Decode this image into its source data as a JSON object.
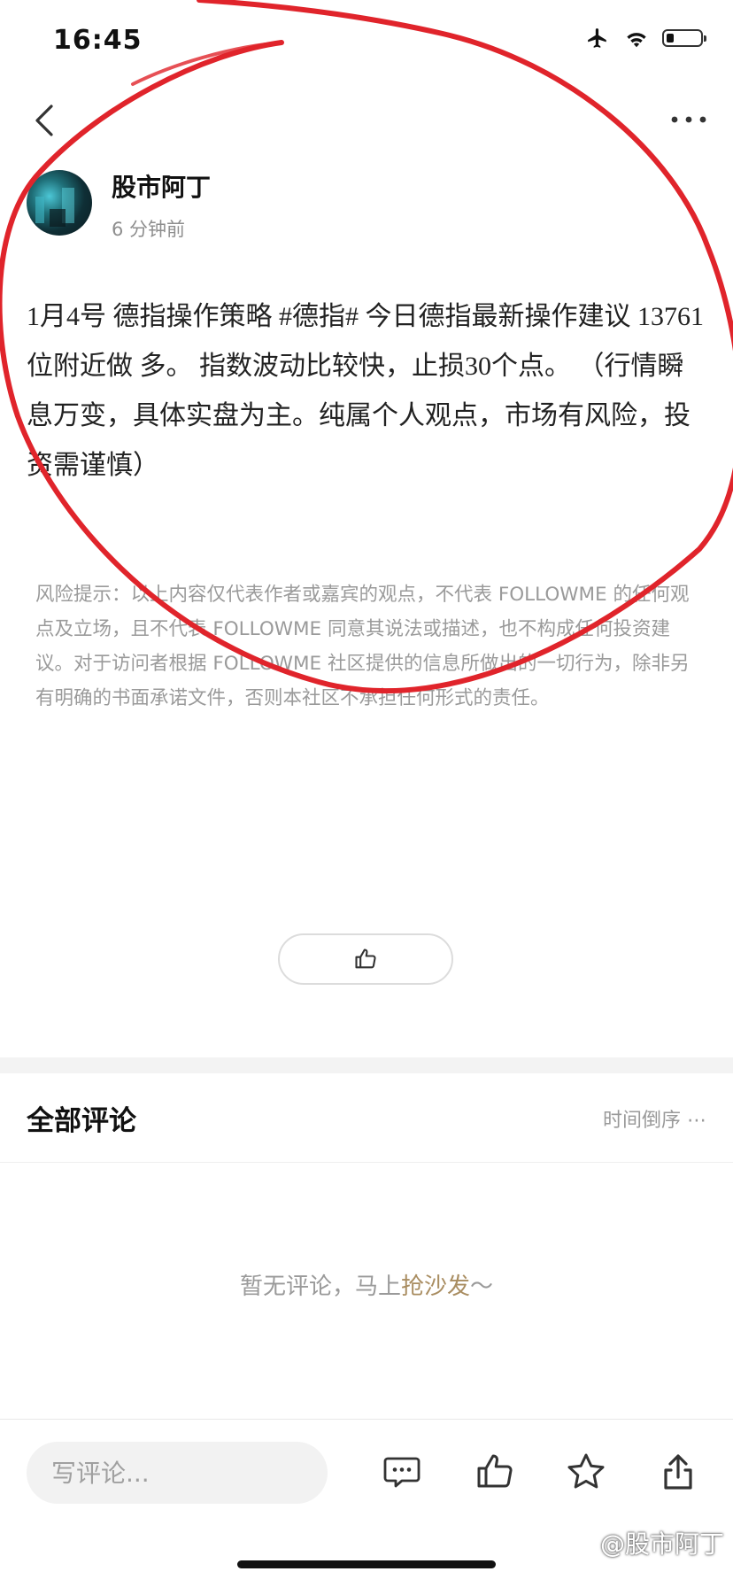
{
  "status_bar": {
    "time": "16:45",
    "battery_level": 0.22
  },
  "author": {
    "name": "股市阿丁",
    "time_ago": "6 分钟前"
  },
  "post": {
    "part1": "1月4号  德指操作策略 ",
    "hashtag": "#德指#",
    "part2": " 今日德指最新操作建议 13761位附近做 多。  指数波动比较快，止损30个点。                       （行情瞬息万变，具体实盘为主。纯属个人观点，市场有风险，投资需谨慎）"
  },
  "risk_notice": "风险提示：以上内容仅代表作者或嘉宾的观点，不代表 FOLLOWME 的任何观点及立场，且不代表 FOLLOWME 同意其说法或描述，也不构成任何投资建议。对于访问者根据 FOLLOWME 社区提供的信息所做出的一切行为，除非另有明确的书面承诺文件，否则本社区不承担任何形式的责任。",
  "comments": {
    "title": "全部评论",
    "sort": "时间倒序 ⋯",
    "empty_prefix": "暂无评论，马上",
    "empty_link": "抢沙发",
    "empty_suffix": "～"
  },
  "bottom_bar": {
    "comment_placeholder": "写评论..."
  },
  "watermark": "@股市阿丁",
  "colors": {
    "link": "#a98d61",
    "annotation": "#e0242b"
  }
}
